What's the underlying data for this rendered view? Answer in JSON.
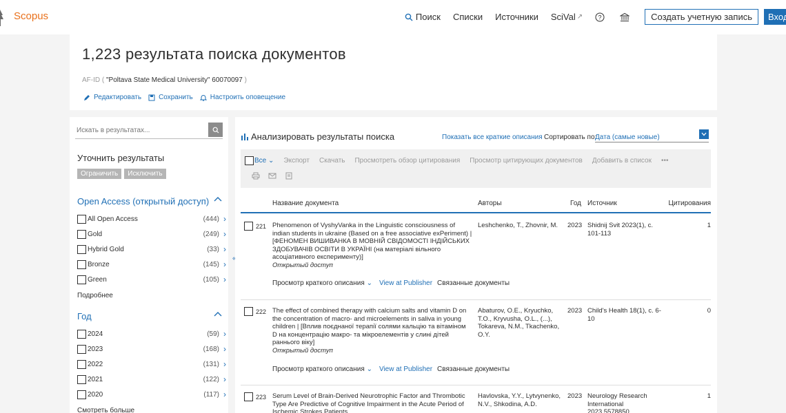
{
  "header": {
    "brand": "Scopus",
    "nav": {
      "search": "Поиск",
      "lists": "Списки",
      "sources": "Источники",
      "scival": "SciVal",
      "scival_ext": "↗",
      "signup": "Создать учетную запись",
      "login": "Вход"
    }
  },
  "results": {
    "title": "1,223 результата поиска документов",
    "query_prefix": "AF-ID (",
    "query_affil": "\"Poltava State Medical University\"",
    "query_id": "60070097",
    "query_suffix": ")",
    "actions": {
      "edit": "Редактировать",
      "save": "Сохранить",
      "alert": "Настроить оповещение"
    }
  },
  "sidebar": {
    "search_placeholder": "Искать в результатах...",
    "refine_title": "Уточнить результаты",
    "limit": "Ограничить",
    "exclude": "Исключить",
    "open_access": {
      "title": "Open Access (открытый доступ)",
      "items": [
        {
          "label": "All Open Access",
          "count": "(444)"
        },
        {
          "label": "Gold",
          "count": "(249)"
        },
        {
          "label": "Hybrid Gold",
          "count": "(33)"
        },
        {
          "label": "Bronze",
          "count": "(145)"
        },
        {
          "label": "Green",
          "count": "(105)"
        }
      ],
      "more": "Подробнее"
    },
    "year": {
      "title": "Год",
      "items": [
        {
          "label": "2024",
          "count": "(59)"
        },
        {
          "label": "2023",
          "count": "(168)"
        },
        {
          "label": "2022",
          "count": "(131)"
        },
        {
          "label": "2021",
          "count": "(122)"
        },
        {
          "label": "2020",
          "count": "(117)"
        }
      ],
      "more": "Смотреть больше"
    }
  },
  "main": {
    "analyze": "Анализировать результаты поиска",
    "show_abstracts": "Показать все краткие описания",
    "sort_label": "Сортировать по:",
    "sort_value": "Дата (самые новые)",
    "toolbar": {
      "all": "Все",
      "export": "Экспорт",
      "download": "Скачать",
      "citation_overview": "Просмотреть обзор цитирования",
      "citing_docs": "Просмотр цитирующих документов",
      "add_to_list": "Добавить в список",
      "more": "•••"
    },
    "columns": {
      "title": "Название документа",
      "authors": "Авторы",
      "year": "Год",
      "source": "Источник",
      "citations": "Цитирования"
    },
    "docs": [
      {
        "num": "221",
        "title": "Phenomenon of VyshyVanka in the Linguistic consciousness of indian students in ukraine (Based on a free associative exPeriment) | [ФЕНОМЕН ВИШИВАНКА В МОВНІЙ СВІДОМОСТІ ІНДІЙСЬКИХ ЗДОБУВАЧІВ ОСВІТИ В УКРАЇНІ (на матеріалі вільного асоціативного експерименту)]",
        "oa": "Открытый доступ",
        "authors": "Leshchenko, T., Zhovnir, M.",
        "year": "2023",
        "source": "Shidnij Svit 2023(1), с. 101-113",
        "citations": "1"
      },
      {
        "num": "222",
        "title": "The effect of combined therapy with calcium salts and vitamin D on the concentration of macro- and microelements in saliva in young children | [Вплив поєднаної терапії солями кальцію та вітаміном D на концентрацію макро- та мікроелементів у слині дітей раннього віку]",
        "oa": "Открытый доступ",
        "authors": "Abaturov, O.E., Kryuchko, T.O., Kryvusha, O.L., (...), Tokareva, N.M., Tkachenko, O.Y.",
        "year": "2023",
        "source": "Child's Health 18(1), с. 6-10",
        "citations": "0"
      },
      {
        "num": "223",
        "title": "Serum Level of Brain-Derived Neurotrophic Factor and Thrombotic Type Are Predictive of Cognitive Impairment in the Acute Period of Ischemic Strokes Patients",
        "oa": "",
        "authors": "Havlovska, Y.Y., Lytvynenko, N.V., Shkodina, A.D.",
        "year": "2023",
        "source": "Neurology Research International 2023,5578850",
        "citations": "1"
      }
    ],
    "links": {
      "abstract": "Просмотр краткого описания",
      "publisher": "View at Publisher",
      "related": "Связанные документы"
    }
  }
}
